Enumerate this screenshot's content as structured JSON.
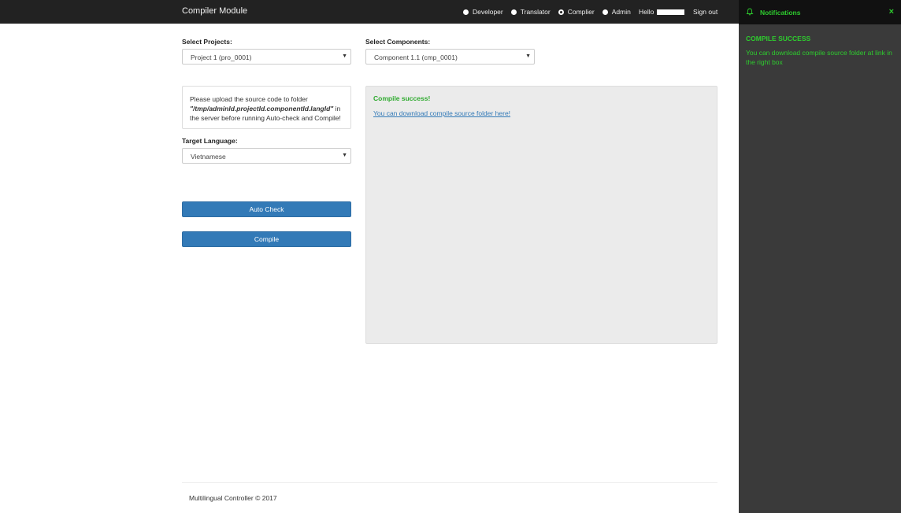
{
  "header": {
    "brand": "Compiler Module",
    "roles": [
      {
        "label": "Developer",
        "checked": false
      },
      {
        "label": "Translator",
        "checked": false
      },
      {
        "label": "Complier",
        "checked": true
      },
      {
        "label": "Admin",
        "checked": false
      }
    ],
    "hello": "Hello",
    "sign_out": "Sign out"
  },
  "form": {
    "projects_label": "Select Projects:",
    "projects_value": "Project 1 (pro_0001)",
    "components_label": "Select Components:",
    "components_value": "Component 1.1 (cmp_0001)",
    "info_prefix": "Please upload the source code to folder",
    "info_path": "\"/tmp/adminId.projectId.componentId.langId\"",
    "info_suffix_1": " in",
    "info_suffix_2": "the server before running Auto-check and Compile!",
    "language_label": "Target Language:",
    "language_value": "Vietnamese",
    "auto_check_label": "Auto Check",
    "compile_label": "Compile"
  },
  "result": {
    "title": "Compile success!",
    "link": "You can download compile source folder here!"
  },
  "footer": {
    "text": "Multilingual Controller © 2017"
  },
  "notifications": {
    "title": "Notifications",
    "close": "×",
    "message_title": "COMPILE SUCCESS",
    "message": "You can download compile source folder at link in the right box"
  },
  "colors": {
    "primary": "#337ab7",
    "success": "#2ecc2e",
    "topbar": "#222222",
    "panel": "#3a3a3a"
  }
}
